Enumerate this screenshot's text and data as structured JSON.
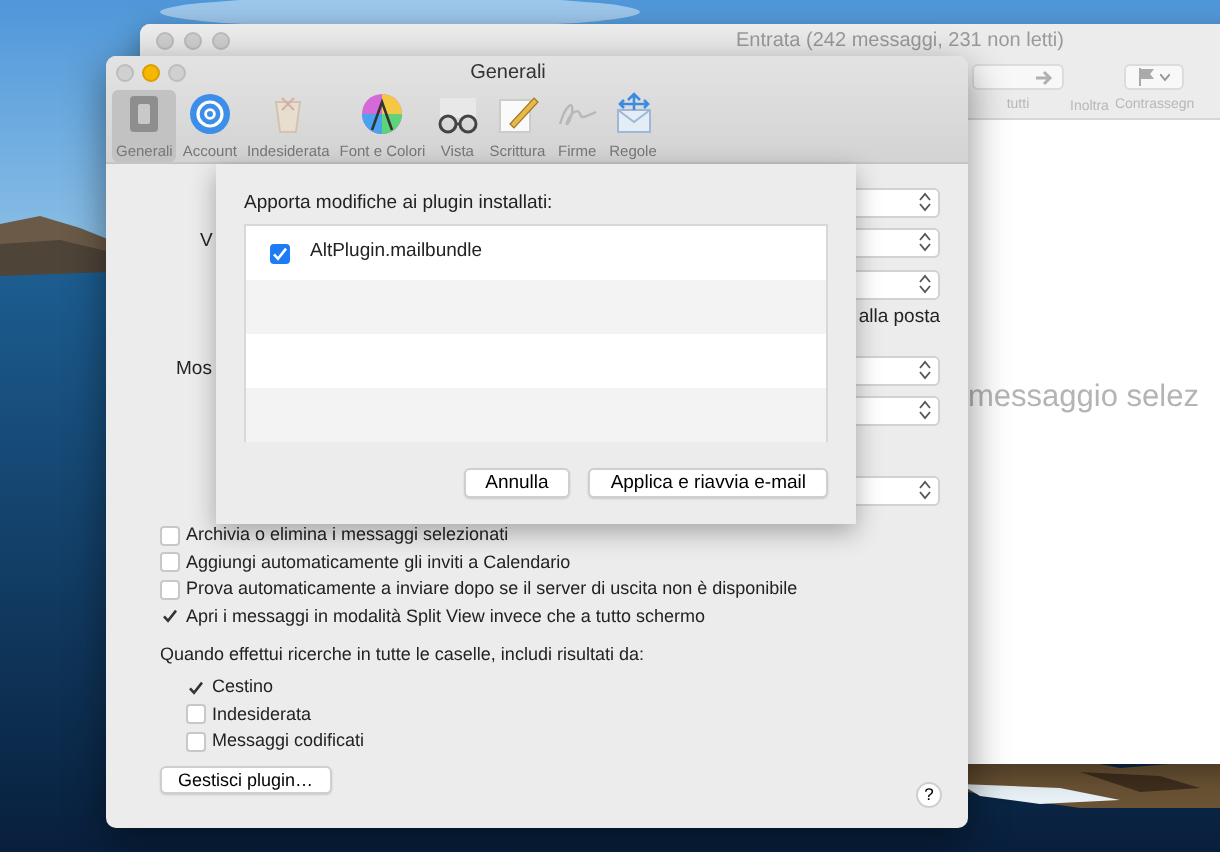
{
  "mail_window": {
    "title": "Entrata (242 messaggi, 231 non letti)",
    "toolbar": [
      {
        "kind": "segmented",
        "label": "tutti"
      },
      {
        "kind": "forward",
        "label": "Inoltra"
      },
      {
        "kind": "flag",
        "label": "Contrassegn"
      }
    ],
    "empty_text": "messaggio selez"
  },
  "prefs_window": {
    "title": "Generali",
    "tabs": [
      {
        "kind": "general",
        "label": "Generali",
        "selected": true
      },
      {
        "kind": "account",
        "label": "Account",
        "selected": false
      },
      {
        "kind": "junk",
        "label": "Indesiderata",
        "selected": false
      },
      {
        "kind": "fonts",
        "label": "Font e Colori",
        "selected": false
      },
      {
        "kind": "view",
        "label": "Vista",
        "selected": false
      },
      {
        "kind": "compose",
        "label": "Scrittura",
        "selected": false
      },
      {
        "kind": "signature",
        "label": "Firme",
        "selected": false
      },
      {
        "kind": "rules",
        "label": "Regole",
        "selected": false
      }
    ],
    "rows": [
      {
        "kind": "popup"
      },
      {
        "kind": "popup",
        "label": "V"
      },
      {
        "kind": "popup"
      },
      {
        "kind": "text",
        "label": "alla posta"
      },
      {
        "kind": "popup",
        "label": "Mos"
      },
      {
        "kind": "popup"
      },
      {
        "kind": "popup"
      }
    ],
    "options": [
      {
        "label": "Archivia o elimina i messaggi selezionati",
        "checked": false
      },
      {
        "label": "Aggiungi automaticamente gli inviti a Calendario",
        "checked": false
      },
      {
        "label": "Prova automaticamente a inviare dopo se il server di uscita non è disponibile",
        "checked": false
      },
      {
        "label": "Apri i messaggi in modalità Split View invece che a tutto schermo",
        "checked": true
      }
    ],
    "search_label": "Quando effettui ricerche in tutte le caselle, includi risultati da:",
    "search_options": [
      {
        "label": "Cestino",
        "checked": true
      },
      {
        "label": "Indesiderata",
        "checked": false
      },
      {
        "label": "Messaggi codificati",
        "checked": false
      }
    ],
    "manage_button": "Gestisci plugin…",
    "help_button": "?"
  },
  "sheet": {
    "label": "Apporta modifiche ai plugin installati:",
    "plugins": [
      {
        "name": "AltPlugin.mailbundle",
        "checked": true
      }
    ],
    "buttons": [
      {
        "label": "Annulla",
        "default": false
      },
      {
        "label": "Applica e riavvia e-mail",
        "default": false
      }
    ]
  }
}
